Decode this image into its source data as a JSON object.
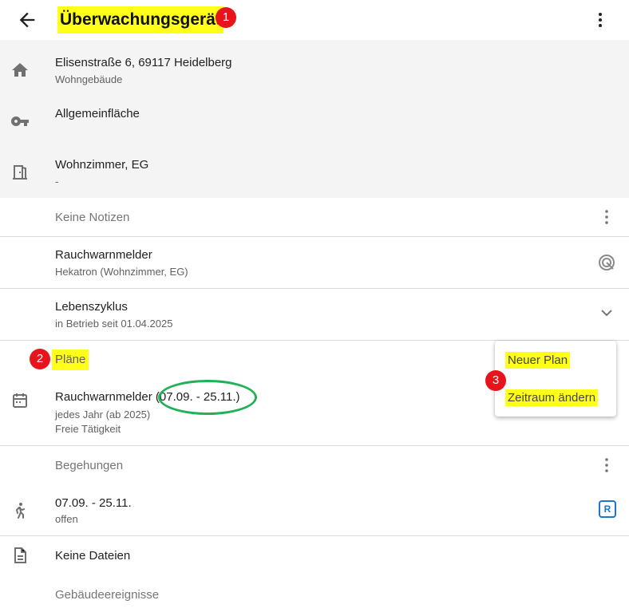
{
  "header": {
    "title": "Überwachungsgerät",
    "badge": "1"
  },
  "location": {
    "address": "Elisenstraße 6, 69117 Heidelberg",
    "building_type": "Wohngebäude",
    "area": "Allgemeinfläche",
    "room": "Wohnzimmer, EG",
    "room_sub": "-"
  },
  "notes": {
    "label": "Keine Notizen"
  },
  "device": {
    "name": "Rauchwarnmelder",
    "sub": "Hekatron (Wohnzimmer, EG)"
  },
  "lifecycle": {
    "label": "Lebenszyklus",
    "sub": "in Betrieb seit 01.04.2025"
  },
  "plans": {
    "label": "Pläne",
    "badge": "2",
    "item_name": "Rauchwarnmelder",
    "item_range": "(07.09. - 25.11.)",
    "item_sub1": "jedes Jahr (ab 2025)",
    "item_sub2": "Freie Tätigkeit"
  },
  "popup_menu": {
    "item1": "Neuer Plan",
    "item2": "Zeitraum ändern",
    "badge": "3"
  },
  "inspections": {
    "label": "Begehungen",
    "item_range": "07.09. - 25.11.",
    "item_status": "offen",
    "item_badge": "R"
  },
  "files": {
    "label": "Keine Dateien"
  },
  "events": {
    "label": "Gebäudeereignisse"
  },
  "colors": {
    "highlight": "#ffff1a",
    "badge_red": "#e8141b",
    "circle_green": "#1fb257",
    "accent_blue": "#1976d2"
  }
}
